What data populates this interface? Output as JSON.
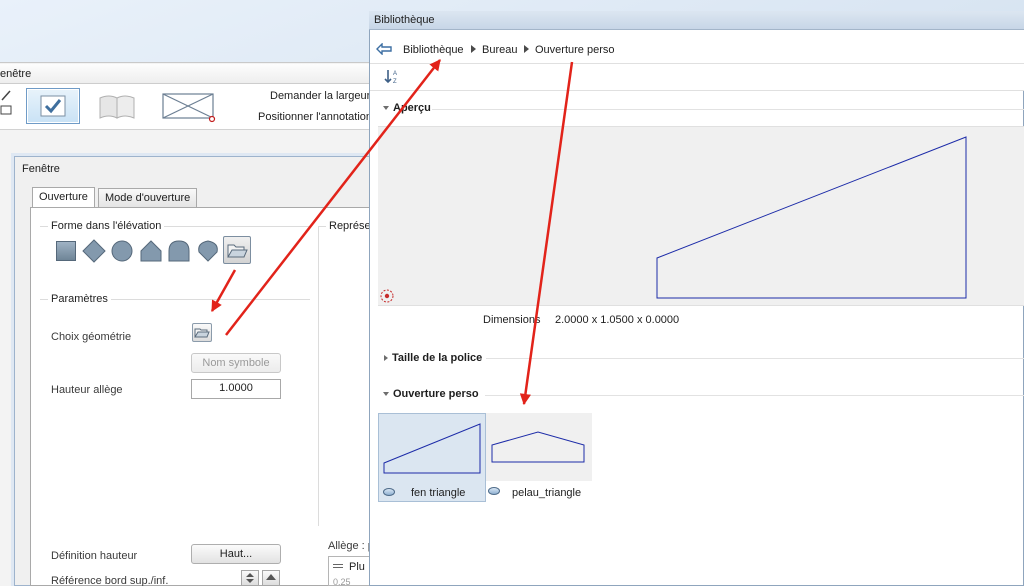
{
  "background_window": {
    "title": "enêtre",
    "toolbar": {
      "request_width": "Demander la largeur",
      "position_annotation": "Positionner l'annotation"
    }
  },
  "fenetre_dialog": {
    "title": "Fenêtre",
    "tabs": [
      {
        "label": "Ouverture",
        "active": true
      },
      {
        "label": "Mode d'ouverture",
        "active": false
      }
    ],
    "groups": {
      "forme": "Forme dans l'élévation",
      "representation": "Représer",
      "parametres": "Paramètres"
    },
    "shapes": [
      "rectangle-icon",
      "diamond-icon",
      "circle-icon",
      "pentagon-icon",
      "arch-icon",
      "drop-icon",
      "folder-open-icon"
    ],
    "fields": {
      "choix_geometrie": "Choix géométrie",
      "nom_symbole": "Nom symbole",
      "hauteur_allege_label": "Hauteur allège",
      "hauteur_allege_value": "1.0000",
      "definition_hauteur": "Définition hauteur",
      "haut_button": "Haut...",
      "reference_bord": "Référence bord sup./inf.",
      "allege_label": "Allège : p",
      "plus_label": "Plu",
      "partial_value": "0.25"
    }
  },
  "bibliotheque": {
    "title": "Bibliothèque",
    "breadcrumb": [
      "Bibliothèque",
      "Bureau",
      "Ouverture perso"
    ],
    "sort_icon": "sort-az-icon",
    "sections": {
      "apercu": "Aperçu",
      "taille_police": "Taille de la police",
      "ouverture_perso": "Ouverture perso"
    },
    "dimensions_label": "Dimensions",
    "dimensions_value": "2.0000 x 1.0500 x 0.0000",
    "items": [
      {
        "label": "fen triangle",
        "selected": true
      },
      {
        "label": "pelau_triangle",
        "selected": false
      }
    ]
  },
  "colors": {
    "annotation_arrow": "#e2231a",
    "shape_stroke": "#1c2ba8",
    "accent": "#4a7fb5"
  }
}
